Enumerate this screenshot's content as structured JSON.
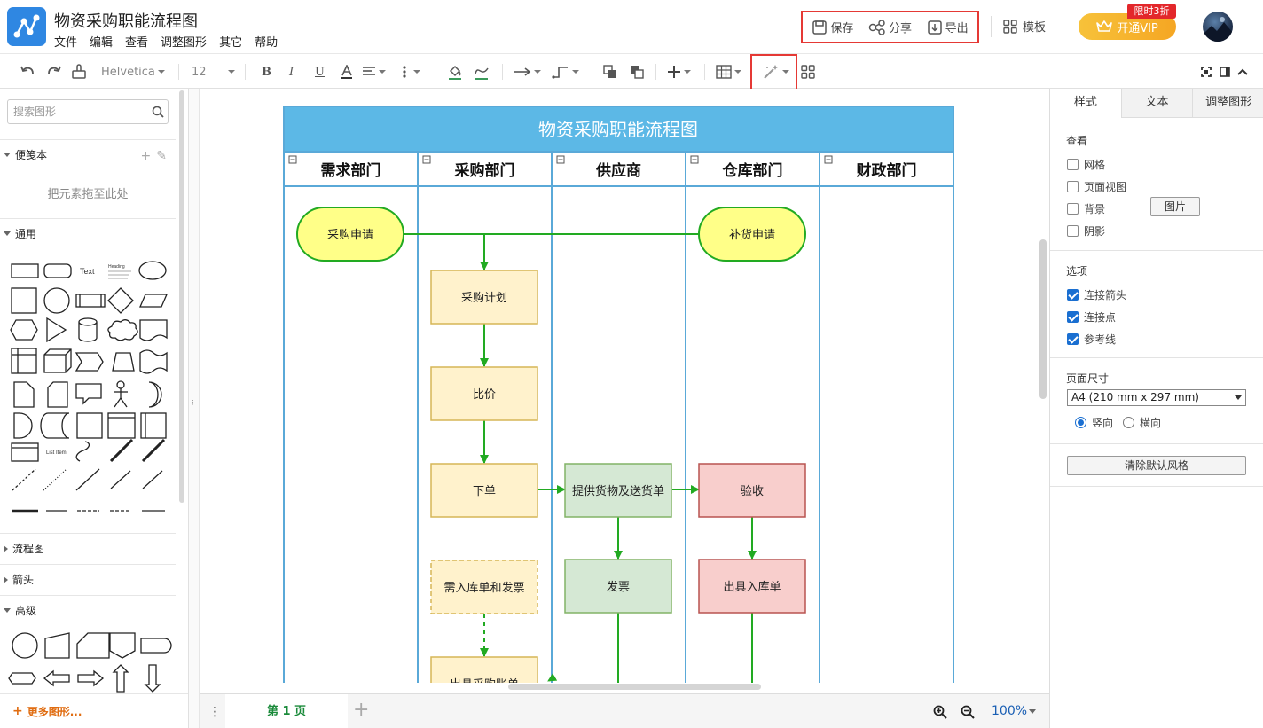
{
  "app": {
    "title": "物资采购职能流程图",
    "menu": [
      "文件",
      "编辑",
      "查看",
      "调整图形",
      "其它",
      "帮助"
    ]
  },
  "top_actions": {
    "save": "保存",
    "share": "分享",
    "export": "导出"
  },
  "template_label": "模板",
  "vip": {
    "label": "开通VIP",
    "badge": "限时3折"
  },
  "toolbar": {
    "font_family": "Helvetica",
    "font_size": "12"
  },
  "sidebar": {
    "search_placeholder": "搜索图形",
    "scratchpad": "便笺本",
    "drop_hint": "把元素拖至此处",
    "general": "通用",
    "text_shape_label": "Text",
    "heading_shape_label": "Heading",
    "list_item_label": "List Item",
    "sections": [
      "流程图",
      "箭头",
      "高级"
    ],
    "more_shapes": "更多图形..."
  },
  "diagram": {
    "title": "物资采购职能流程图",
    "lanes": [
      "需求部门",
      "采购部门",
      "供应商",
      "仓库部门",
      "财政部门"
    ],
    "nodes": {
      "purchase_request": "采购申请",
      "restock_request": "补货申请",
      "purchase_plan": "采购计划",
      "compare_price": "比价",
      "place_order": "下单",
      "supply_delivery": "提供货物及送货单",
      "inspect": "验收",
      "invoice": "发票",
      "inbound_slip": "出具入库单",
      "need_inbound_invoice": "需入库单和发票",
      "purchase_bill": "出具采购账单"
    },
    "colors": {
      "header": "#5cb8e6",
      "lane_border": "#5aa9d8",
      "connector": "#22aa22",
      "terminal_fill": "#ffff88",
      "terminal_stroke": "#22aa22",
      "process_fill": "#fff2cc",
      "process_stroke": "#d6b656",
      "supplier_fill": "#d5e8d4",
      "supplier_stroke": "#82b366",
      "warehouse_fill": "#f8cecc",
      "warehouse_stroke": "#b85450"
    }
  },
  "bottom": {
    "page_tab": "第 1 页",
    "zoom": "100%"
  },
  "right_panel": {
    "tabs": [
      "样式",
      "文本",
      "调整图形"
    ],
    "view_title": "查看",
    "view_options": [
      "网格",
      "页面视图",
      "背景",
      "阴影"
    ],
    "image_button": "图片",
    "options_title": "选项",
    "options": [
      "连接箭头",
      "连接点",
      "参考线"
    ],
    "page_size_title": "页面尺寸",
    "page_size_value": "A4 (210 mm x 297 mm)",
    "orientation": [
      "竖向",
      "横向"
    ],
    "reset_style": "清除默认风格"
  }
}
